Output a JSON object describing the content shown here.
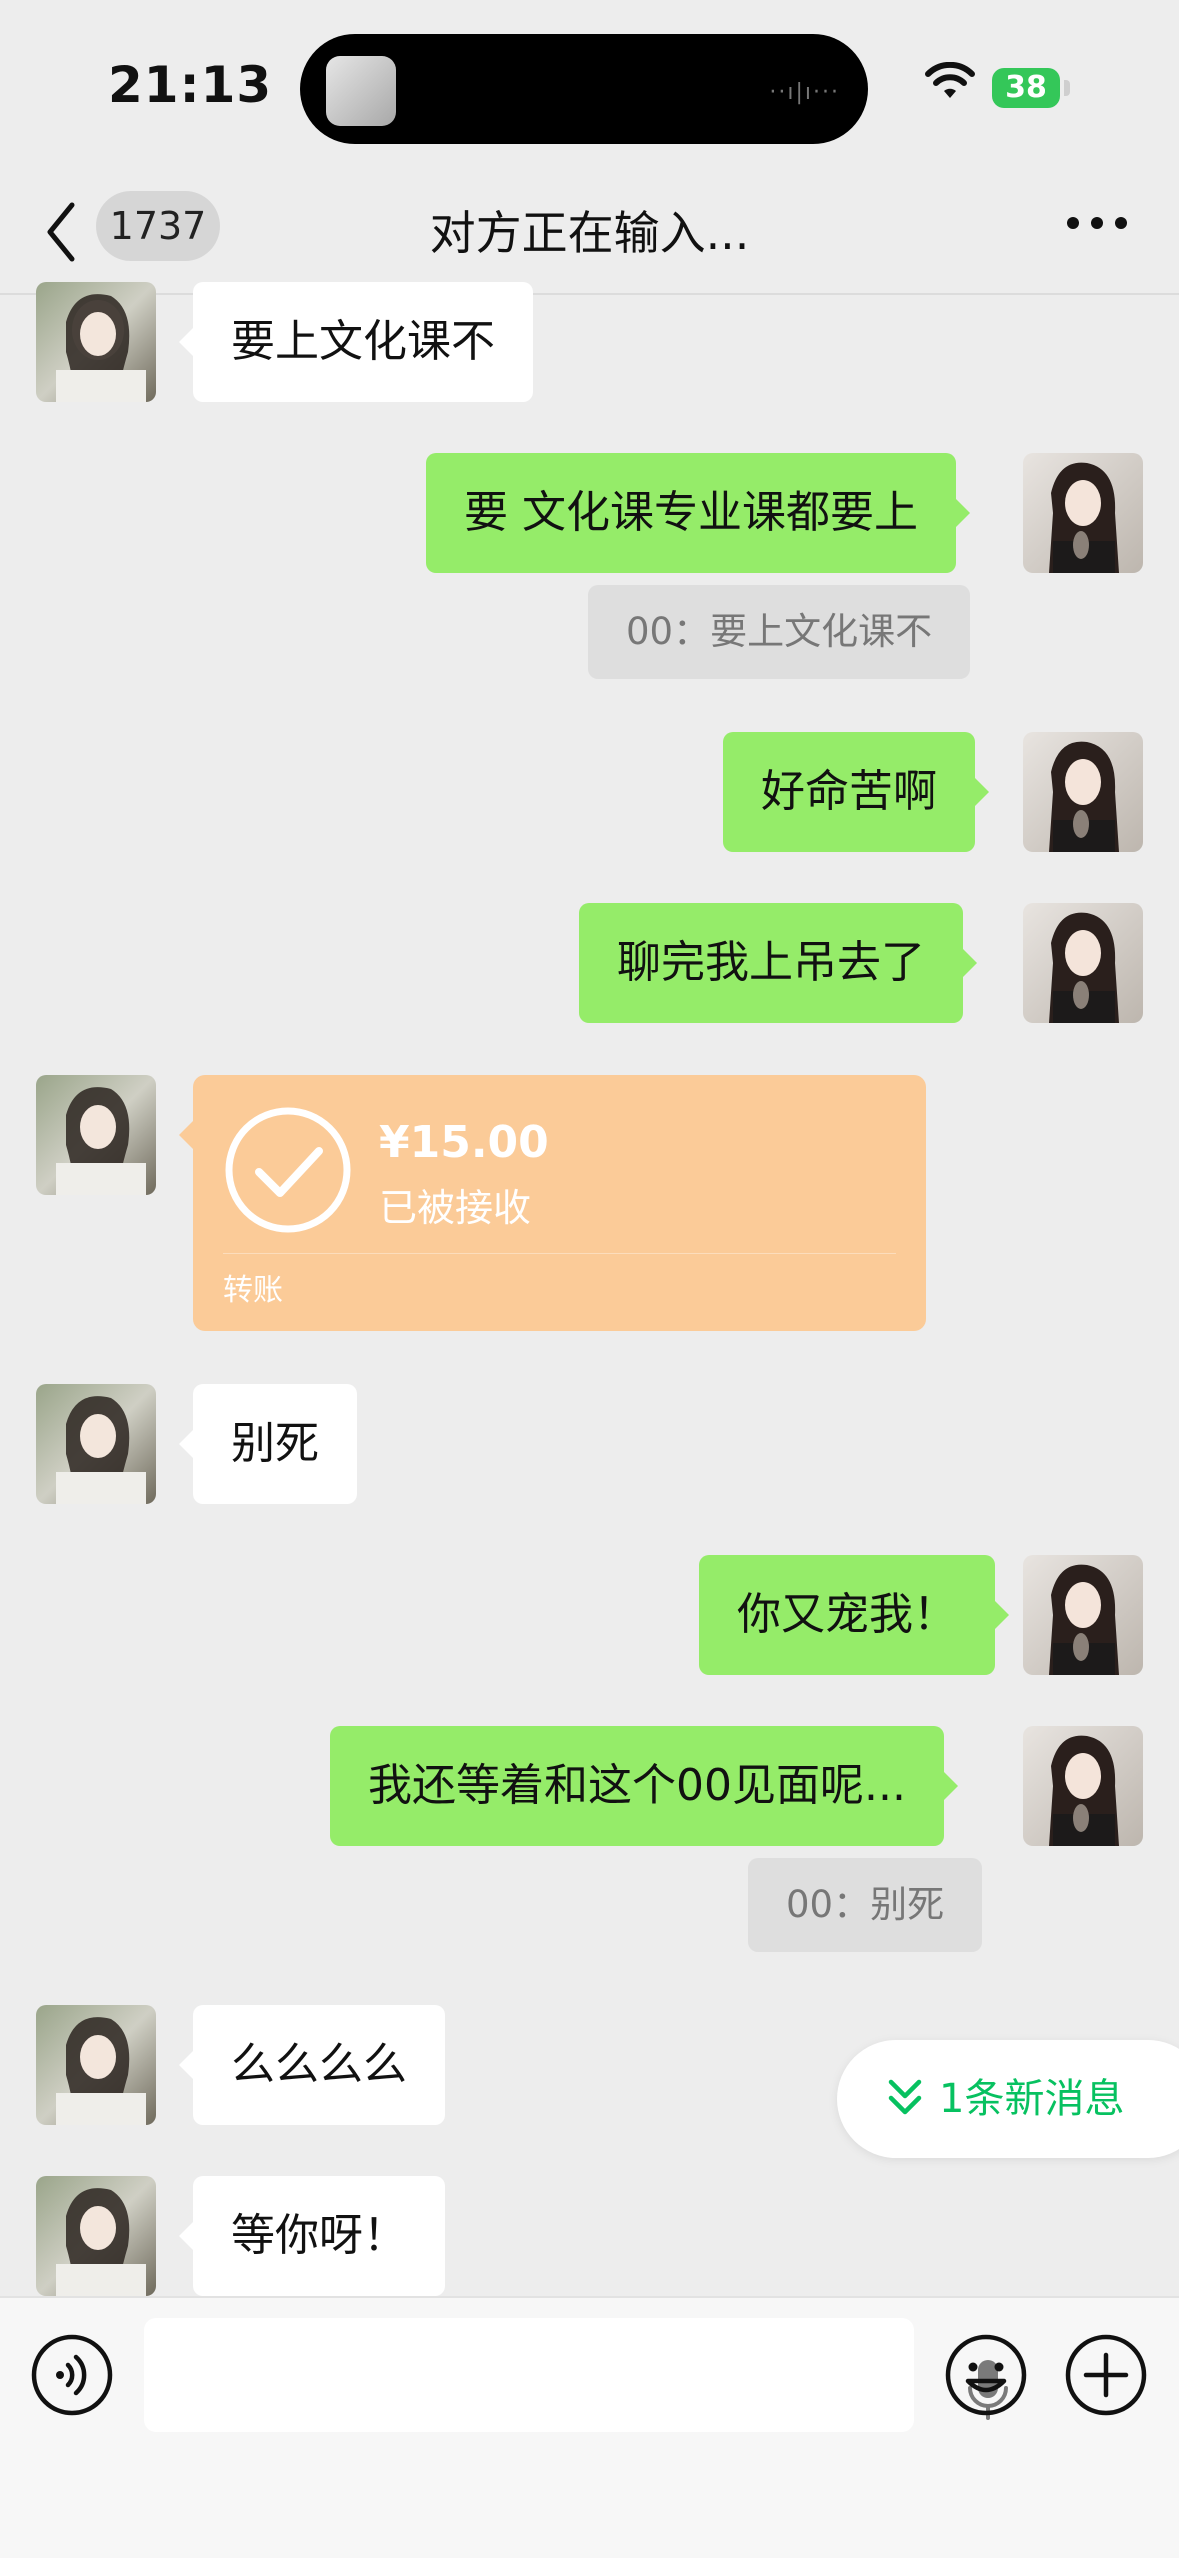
{
  "status_bar": {
    "time": "21:13",
    "battery": "38"
  },
  "nav": {
    "unread_count": "1737",
    "title": "对方正在输入..."
  },
  "messages": [
    {
      "side": "left",
      "text": "要上文化课不"
    },
    {
      "side": "right",
      "text": "要 文化课专业课都要上",
      "quote": "00：要上文化课不"
    },
    {
      "side": "right",
      "text": "好命苦啊"
    },
    {
      "side": "right",
      "text": "聊完我上吊去了"
    },
    {
      "side": "left",
      "type": "transfer",
      "amount": "¥15.00",
      "status": "已被接收",
      "label": "转账"
    },
    {
      "side": "left",
      "text": "别死"
    },
    {
      "side": "right",
      "text": "你又宠我！"
    },
    {
      "side": "right",
      "text": "我还等着和这个00见面呢...",
      "quote": "00：别死"
    },
    {
      "side": "left",
      "text": "么么么么"
    },
    {
      "side": "left",
      "text": "等你呀！"
    }
  ],
  "new_message_pill": "1条新消息",
  "colors": {
    "sent_bubble": "#95ec69",
    "received_bubble": "#ffffff",
    "transfer_card": "#fbcb98",
    "accent_green": "#07c160",
    "background": "#ededed"
  },
  "icons": [
    "back-chevron-icon",
    "more-dots-icon",
    "wifi-icon",
    "voice-mode-icon",
    "microphone-icon",
    "emoji-icon",
    "plus-icon",
    "check-circle-icon",
    "double-chevron-down-icon"
  ]
}
